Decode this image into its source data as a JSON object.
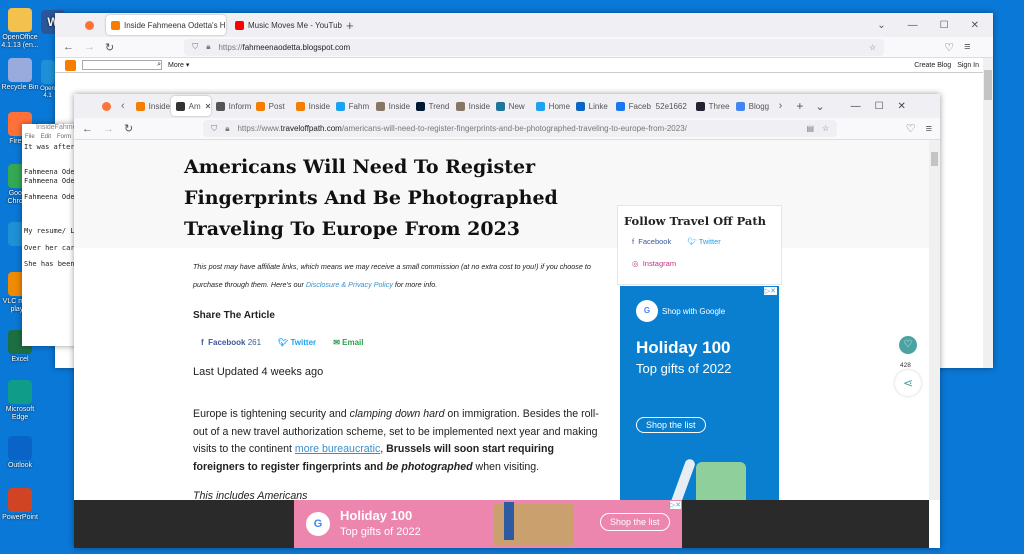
{
  "desktop": {
    "icons": [
      {
        "label": "OpenOffice 4.1.13 (en...",
        "color": "#f2c14e"
      },
      {
        "label": "Recycle Bin",
        "color": "#9ad"
      },
      {
        "label": "Firefox",
        "color": "#ff7139"
      },
      {
        "label": "Google Chrome",
        "color": "#34a853"
      },
      {
        "label": "",
        "color": "#1e90d6"
      },
      {
        "label": "VLC media player",
        "color": "#f08a00"
      },
      {
        "label": "Excel",
        "color": "#1d6f42"
      },
      {
        "label": "Microsoft Edge",
        "color": "#0f9d8a"
      },
      {
        "label": "Outlook",
        "color": "#0a64c8"
      },
      {
        "label": "PowerPoint",
        "color": "#d04423"
      }
    ],
    "second_col": [
      {
        "label": "W"
      },
      {
        "label": "Open 4.1"
      }
    ]
  },
  "notepad": {
    "title": "InsideFahmee",
    "menu": [
      "File",
      "Edit",
      "Form"
    ],
    "lines": [
      "It was after",
      "",
      "",
      "Fahmeena Ode",
      "Fahmeena Ode",
      "",
      "Fahmeena Ode",
      "",
      "",
      "",
      "My resume/ L",
      "",
      "Over her car",
      "",
      "She has been"
    ]
  },
  "back_browser": {
    "tabs": [
      {
        "label": "Inside Fahmeena Odetta's Head",
        "active": true,
        "favicon": "blogger-icon"
      },
      {
        "label": "Music Moves Me - YouTube",
        "favicon": "youtube-icon"
      }
    ],
    "url_prefix": "https://",
    "url_domain": "fahmeenaodetta.blogspot.com",
    "more": "More ▾",
    "create_blog": "Create Blog",
    "sign_in": "Sign In"
  },
  "front_browser": {
    "tabs": [
      {
        "label": "Inside",
        "favicon": "blogger-icon",
        "color": "#f57d00"
      },
      {
        "label": "Am",
        "favicon": "location-icon",
        "color": "#333",
        "active": true
      },
      {
        "label": "Inform",
        "favicon": "lock-icon",
        "color": "#555"
      },
      {
        "label": "Post",
        "favicon": "blogger-icon",
        "color": "#f57d00"
      },
      {
        "label": "Inside",
        "favicon": "blogger-icon",
        "color": "#f57d00"
      },
      {
        "label": "Fahm",
        "favicon": "twitter-icon",
        "color": "#1da1f2"
      },
      {
        "label": "Inside",
        "favicon": "image-icon",
        "color": "#876"
      },
      {
        "label": "Trend",
        "favicon": "tumblr-icon",
        "color": "#001935"
      },
      {
        "label": "Inside",
        "favicon": "image-icon",
        "color": "#876"
      },
      {
        "label": "New",
        "favicon": "wordpress-icon",
        "color": "#21759b"
      },
      {
        "label": "Home",
        "favicon": "twitter-icon",
        "color": "#1da1f2"
      },
      {
        "label": "Linke",
        "favicon": "linkedin-icon",
        "color": "#0a66c2"
      },
      {
        "label": "Faceb",
        "favicon": "facebook-icon",
        "color": "#1877f2"
      },
      {
        "label": "52e1662",
        "favicon": "",
        "color": ""
      },
      {
        "label": "Three",
        "favicon": "threads-icon",
        "color": "#223"
      },
      {
        "label": "Blogg",
        "favicon": "google-icon",
        "color": "#4285f4"
      }
    ],
    "url_prefix": "https://www.",
    "url_domain": "traveloffpath.com",
    "url_path": "/americans-will-need-to-register-fingerprints-and-be-photographed-traveling-to-europe-from-2023/"
  },
  "article": {
    "title": "Americans Will Need To Register Fingerprints And Be Photographed Traveling To Europe From 2023",
    "disclaimer_pre": "This post may have affiliate links, which means we may receive a small commission (at no extra cost to you!) if you choose to purchase through them. Here's our ",
    "disclaimer_link": "Disclosure & Privacy Policy",
    "disclaimer_post": " for more info.",
    "share_heading": "Share The Article",
    "share": {
      "facebook": "Facebook",
      "facebook_count": "261",
      "twitter": "Twitter",
      "email": "Email"
    },
    "last_updated": "Last Updated 4 weeks ago",
    "p1": {
      "a": "Europe is tightening security and ",
      "b": "clamping down hard",
      "c": " on immigration. Besides the roll-out of a new travel authorization scheme, set to be implemented next year and making visits to the continent ",
      "link": "more bureaucratic",
      "d": ", ",
      "e": "Brussels will soon start requiring foreigners to register fingerprints and ",
      "f": "be photographed",
      "g": " when visiting."
    },
    "p2": "This includes Americans"
  },
  "sidebar": {
    "heading": "Follow Travel Off Path",
    "facebook": "Facebook",
    "twitter": "Twitter",
    "instagram": "Instagram"
  },
  "side_ad": {
    "brand": "Shop with Google",
    "title": "Holiday 100",
    "subtitle": "Top gifts of 2022",
    "cta": "Shop the list",
    "bg": "#0a7fd0"
  },
  "bottom_ad": {
    "title": "Holiday 100",
    "subtitle": "Top gifts of 2022",
    "cta": "Shop the list",
    "bg": "#ec86ae"
  },
  "floating": {
    "like_count": "428",
    "accent": "#4aa3a2"
  }
}
